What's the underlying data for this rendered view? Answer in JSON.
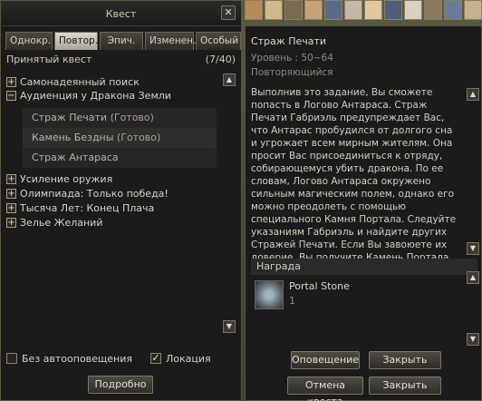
{
  "window": {
    "title": "Квест",
    "close_icon": "close-icon"
  },
  "tabs": [
    {
      "label": "Однокр.",
      "active": false
    },
    {
      "label": "Повтор.",
      "active": true
    },
    {
      "label": "Эпич.",
      "active": false
    },
    {
      "label": "Изменен.",
      "active": false
    },
    {
      "label": "Особый",
      "active": false
    }
  ],
  "quest_list": {
    "header": "Принятый квест",
    "count": "(7/40)",
    "items": [
      {
        "label": "Самонадеянный поиск",
        "expanded": false
      },
      {
        "label": "Аудиенция у Дракона Земли",
        "expanded": true
      },
      {
        "label": "Усиление оружия",
        "expanded": false
      },
      {
        "label": "Олимпиада: Только победа!",
        "expanded": false
      },
      {
        "label": "Тысяча Лет: Конец Плача",
        "expanded": false
      },
      {
        "label": "Зелье Желаний",
        "expanded": false
      }
    ],
    "subquests": [
      {
        "name": "Страж Печати",
        "status": "(Готово)"
      },
      {
        "name": "Камень Бездны",
        "status": "(Готово)"
      },
      {
        "name": "Страж Антараса",
        "status": ""
      }
    ]
  },
  "options": {
    "no_notify": "Без автооповещения",
    "location": "Локация",
    "details_button": "Подробно"
  },
  "details": {
    "name": "Страж Печати",
    "level": "Уровень :  50~64",
    "repeat": "Повторяющийся",
    "description": "Выполнив это задание, Вы сможете попасть в Логово Антараса. Страж Печати Габриэль предупреждает Вас, что Антарас пробудился от долгого сна и угрожает всем мирным жителям. Она просит Вас присоединиться к отряду, собирающемуся убить дракона. По ее словам, Логово Антараса окружено сильным магическим полем, однако его можно преодолеть с помощью специального Камня Портала. Следуйте указаниям Габриэль и найдите других Стражей Печати. Если Вы завоюете их доверие, Вы получите Камень Портала.",
    "reward_header": "Награда",
    "reward_item": "Portal Stone",
    "reward_qty": "1"
  },
  "buttons": {
    "notify": "Оповещение",
    "close1": "Закрыть",
    "cancel_quest": "Отмена квеста",
    "close2": "Закрыть"
  },
  "colors": {
    "accent": "#a89f88",
    "panel": "#1b1b1b"
  }
}
